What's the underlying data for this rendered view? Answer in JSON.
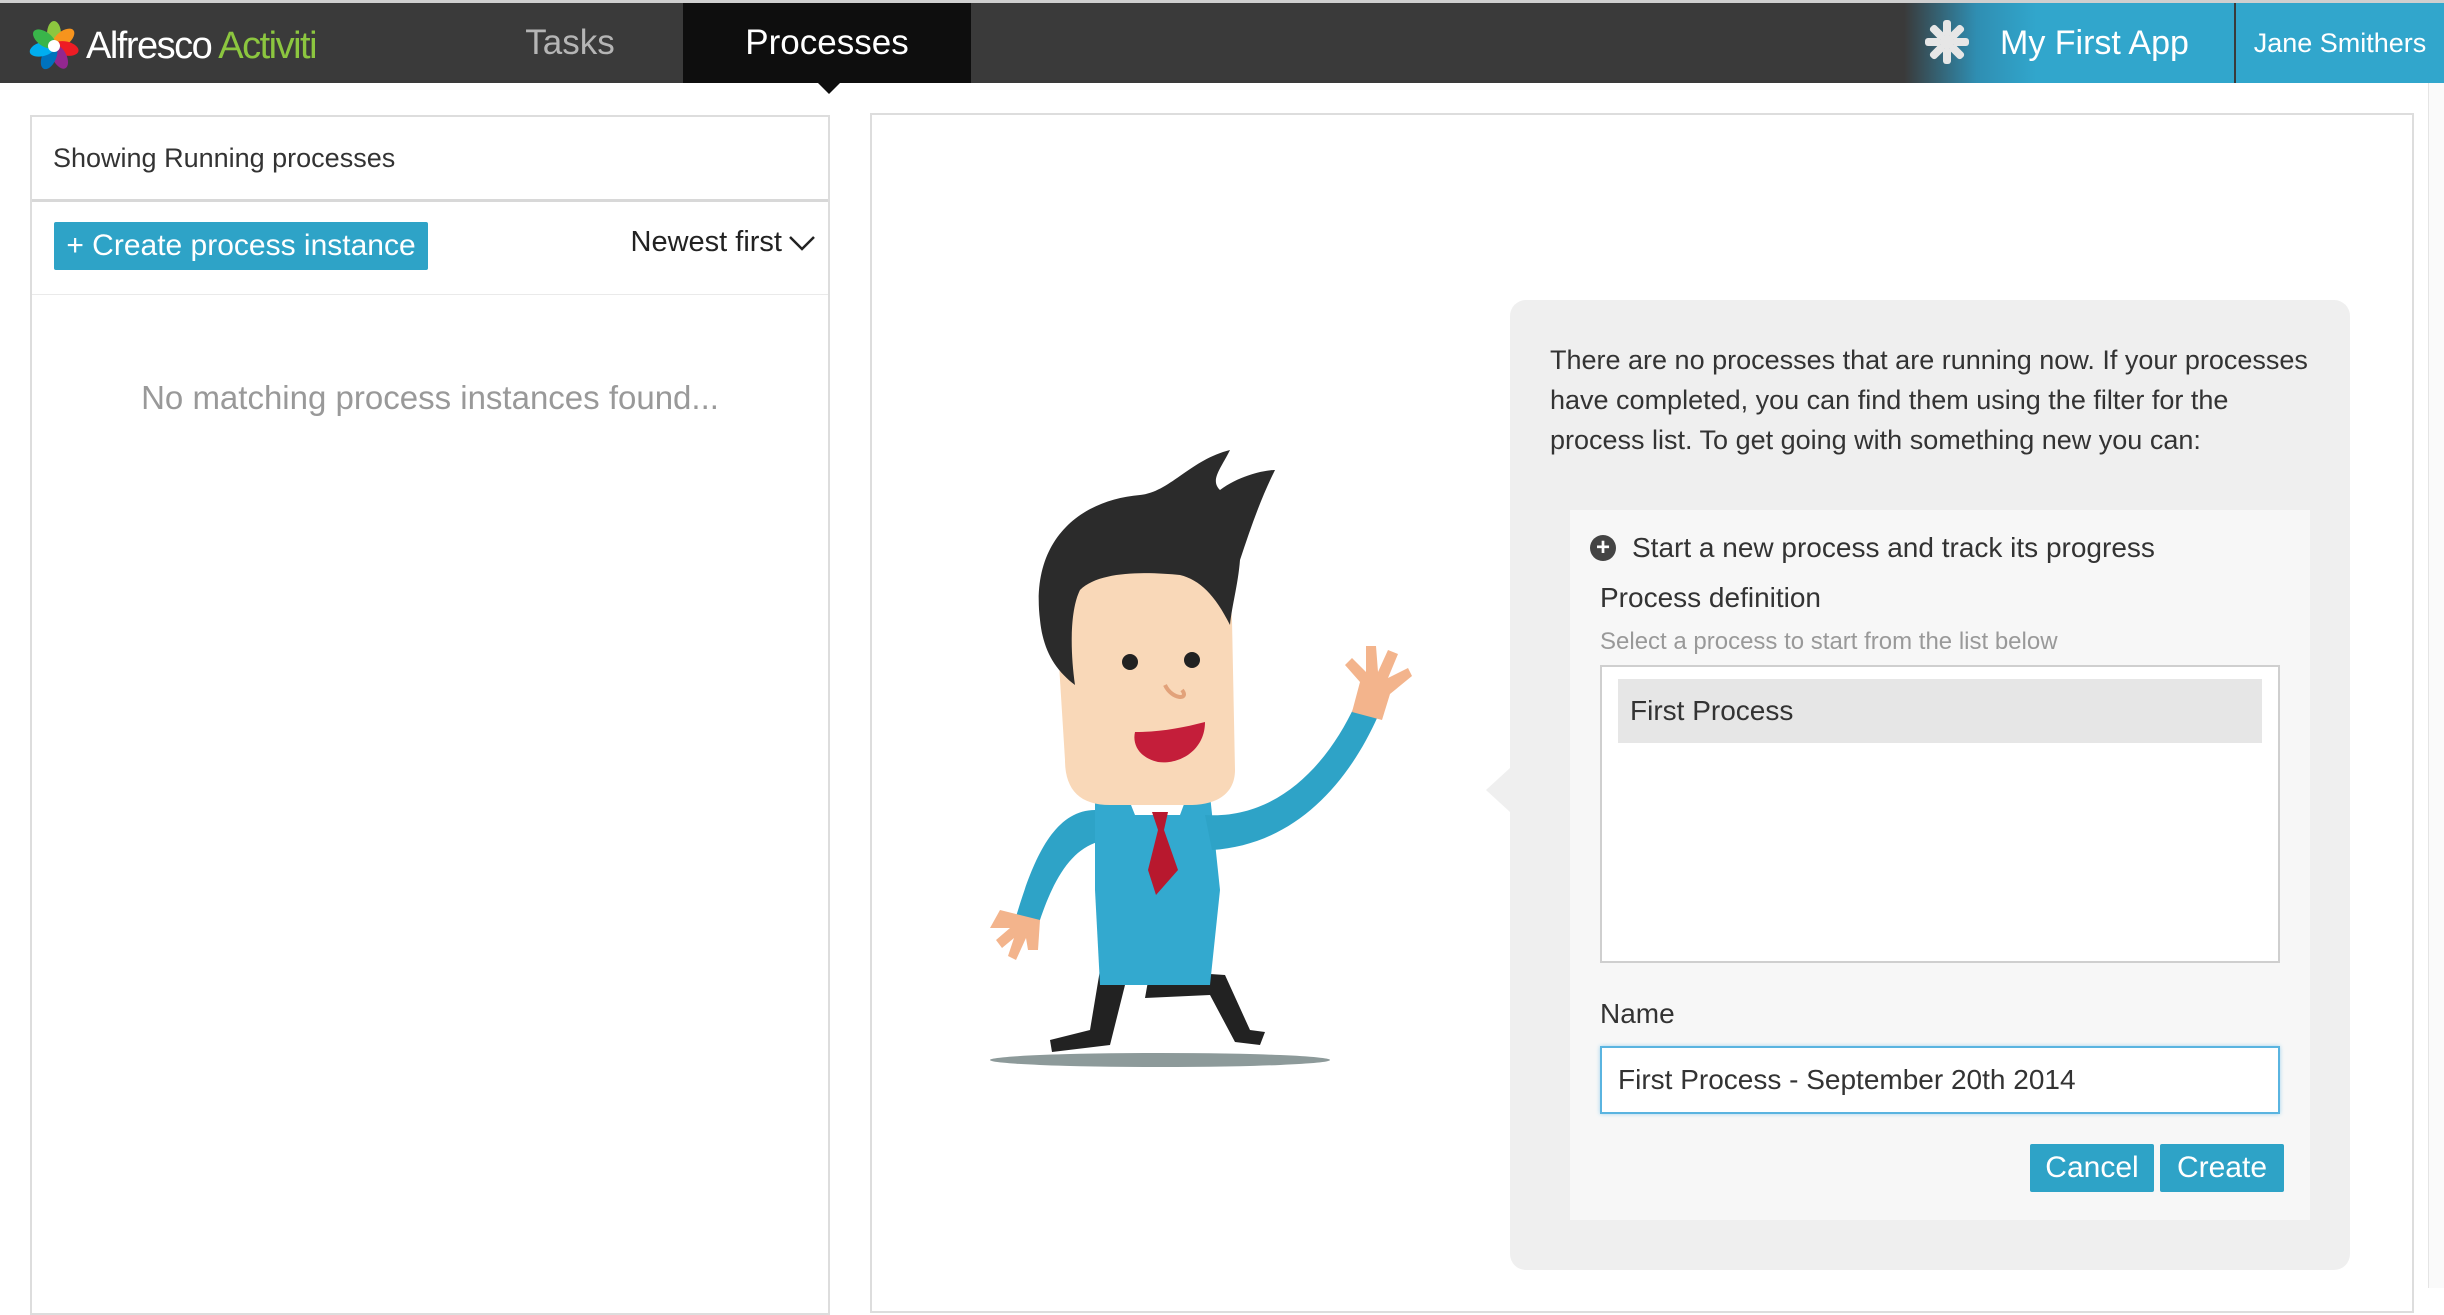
{
  "header": {
    "logo_text_1": "Alfresco",
    "logo_text_2": "Activiti",
    "tabs": [
      {
        "label": "Tasks",
        "active": false
      },
      {
        "label": "Processes",
        "active": true
      }
    ],
    "app_name": "My First App",
    "user_name": "Jane Smithers",
    "icons": [
      "alfresco-logo-icon",
      "app-asterisk-icon"
    ]
  },
  "sidebar": {
    "header": "Showing Running processes",
    "create_button": "+ Create process instance",
    "sort_label": "Newest first",
    "empty_message": "No matching process instances found..."
  },
  "main": {
    "intro_text": "There are no processes that are running now. If your processes have completed, you can find them using the filter for the process list. To get going with something new you can:",
    "form": {
      "title": "Start a new process and track its progress",
      "definition_label": "Process definition",
      "definition_hint": "Select a process to start from the list below",
      "definitions": [
        "First Process"
      ],
      "name_label": "Name",
      "name_value": "First Process - September 20th 2014",
      "cancel_label": "Cancel",
      "create_label": "Create"
    }
  },
  "colors": {
    "accent": "#2ea3c7",
    "topbar": "#3a3a3a",
    "active_tab": "#0e0e0e",
    "logo_green": "#8cc63f"
  }
}
